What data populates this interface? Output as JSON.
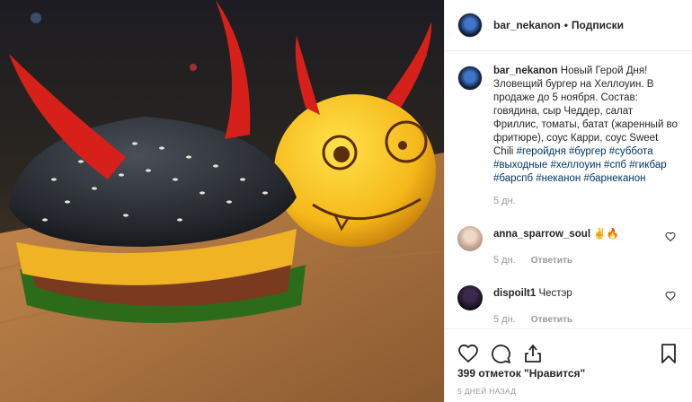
{
  "post": {
    "photo_alt": "Фото бургера",
    "header": {
      "username": "bar_nekanon",
      "separator": "•",
      "follow_label": "Подписки"
    },
    "caption": {
      "username": "bar_nekanon",
      "text": "Новый Герой Дня! Зловещий бургер на Хеллоуин. В продаже до 5 ноября. Состав: говядина, сыр Чеддер, салат Фриллис, томаты, батат (жаренный во фритюре), соус Карри, соус Sweet Chili",
      "hashtags": [
        "#геройдня",
        "#бургер",
        "#суббота",
        "#выходные",
        "#хеллоуин",
        "#спб",
        "#гикбар",
        "#барспб",
        "#неканон",
        "#барнеканон"
      ],
      "time": "5 дн."
    },
    "comments": [
      {
        "username": "anna_sparrow_soul",
        "text": "✌🔥",
        "time": "5 дн.",
        "reply_label": "Ответить"
      },
      {
        "username": "dispoilt1",
        "text": "Честэр",
        "time": "5 дн.",
        "reply_label": "Ответить"
      }
    ],
    "likes_text": "399 отметок \"Нравится\"",
    "posted_ago": "5 ДНЕЙ НАЗАД"
  },
  "icons": [
    "avatar",
    "heart-icon",
    "comment-icon",
    "share-icon",
    "bookmark-icon"
  ],
  "colors": {
    "hashtag": "#003569",
    "muted": "#999999",
    "border": "#efefef"
  }
}
